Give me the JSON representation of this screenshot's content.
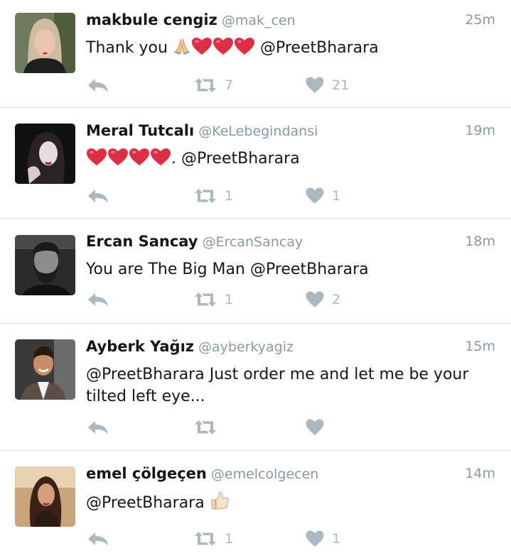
{
  "colors": {
    "text": "#14171a",
    "secondary": "#8899a6",
    "action_icon": "#aab8c2",
    "divider": "#dcdfe2",
    "heart_emoji": "#dd2e44"
  },
  "tweets": [
    {
      "name": "makbule cengiz",
      "handle": "@mak_cen",
      "time": "25m",
      "text_prefix": "Thank you ",
      "emojis": [
        "folded-hands-emoji",
        "heart-emoji",
        "heart-emoji",
        "heart-emoji"
      ],
      "text_suffix": " @PreetBharara",
      "retweets": "7",
      "likes": "21"
    },
    {
      "name": "Meral Tutcalı",
      "handle": "@KeLebegindansi",
      "time": "19m",
      "text_prefix": "",
      "emojis": [
        "heart-emoji",
        "heart-emoji",
        "heart-emoji",
        "heart-emoji"
      ],
      "text_suffix": ". @PreetBharara",
      "retweets": "1",
      "likes": "1"
    },
    {
      "name": "Ercan Sancay",
      "handle": "@ErcanSancay",
      "time": "18m",
      "text_prefix": "You are The Big Man @PreetBharara",
      "emojis": [],
      "text_suffix": "",
      "retweets": "1",
      "likes": "2"
    },
    {
      "name": "Ayberk Yağız",
      "handle": "@ayberkyagiz",
      "time": "15m",
      "text_prefix": "@PreetBharara Just order me and let me be your tilted left eye...",
      "emojis": [],
      "text_suffix": "",
      "retweets": "",
      "likes": ""
    },
    {
      "name": "emel çölgeçen",
      "handle": "@emelcolgecen",
      "time": "14m",
      "text_prefix": "@PreetBharara ",
      "emojis": [
        "thumbs-up-emoji"
      ],
      "text_suffix": "",
      "retweets": "1",
      "likes": "1"
    }
  ]
}
